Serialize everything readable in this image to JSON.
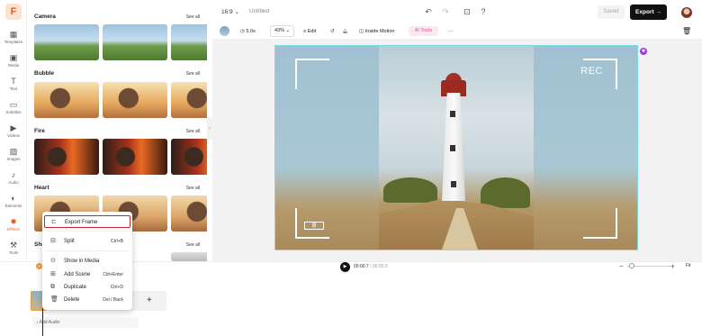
{
  "rail": {
    "items": [
      {
        "icon": "templates-icon",
        "label": "Templates"
      },
      {
        "icon": "media-icon",
        "label": "Media"
      },
      {
        "icon": "text-icon",
        "label": "Text"
      },
      {
        "icon": "subtitles-icon",
        "label": "Subtitles"
      },
      {
        "icon": "videos-icon",
        "label": "Videos"
      },
      {
        "icon": "images-icon",
        "label": "Images"
      },
      {
        "icon": "audio-icon",
        "label": "Audio"
      },
      {
        "icon": "elements-icon",
        "label": "Elements"
      },
      {
        "icon": "effects-icon",
        "label": "Effects"
      },
      {
        "icon": "tools-icon",
        "label": "Tools"
      }
    ],
    "active": "Effects",
    "accent": "#f05a1a"
  },
  "panel": {
    "see_all": "See all",
    "sections": [
      {
        "title": "Camera"
      },
      {
        "title": "Bubble"
      },
      {
        "title": "Fire"
      },
      {
        "title": "Heart"
      },
      {
        "title": "Sha"
      }
    ]
  },
  "topbar": {
    "aspect": "16:9",
    "title": "Untitled",
    "saved": "Saved",
    "export": "Export"
  },
  "toolbar": {
    "duration": "5.0s",
    "zoom": "43%",
    "edit": "Edit",
    "inside_motion": "Inside Motion",
    "ai_tools": "AI Tools",
    "more": "···"
  },
  "canvas": {
    "rec": "REC"
  },
  "timeline": {
    "current": "00:00.7",
    "duration": "/ 00:05.0",
    "fit": "Fit",
    "add_audio": "Add Audio"
  },
  "context_menu": {
    "items": [
      {
        "label": "Export Frame",
        "shortcut": "",
        "icon": "export-frame-icon",
        "highlighted": true
      },
      {
        "label": "Split",
        "shortcut": "Ctrl+B",
        "icon": "split-icon"
      },
      {
        "label": "Show in Media",
        "shortcut": "",
        "icon": "show-in-media-icon"
      },
      {
        "label": "Add Scene",
        "shortcut": "Ctrl+Enter",
        "icon": "add-scene-icon"
      },
      {
        "label": "Duplicate",
        "shortcut": "Ctrl+D",
        "icon": "duplicate-icon"
      },
      {
        "label": "Delete",
        "shortcut": "Del / Back",
        "icon": "delete-icon"
      }
    ],
    "highlight_color": "#c8242a"
  }
}
